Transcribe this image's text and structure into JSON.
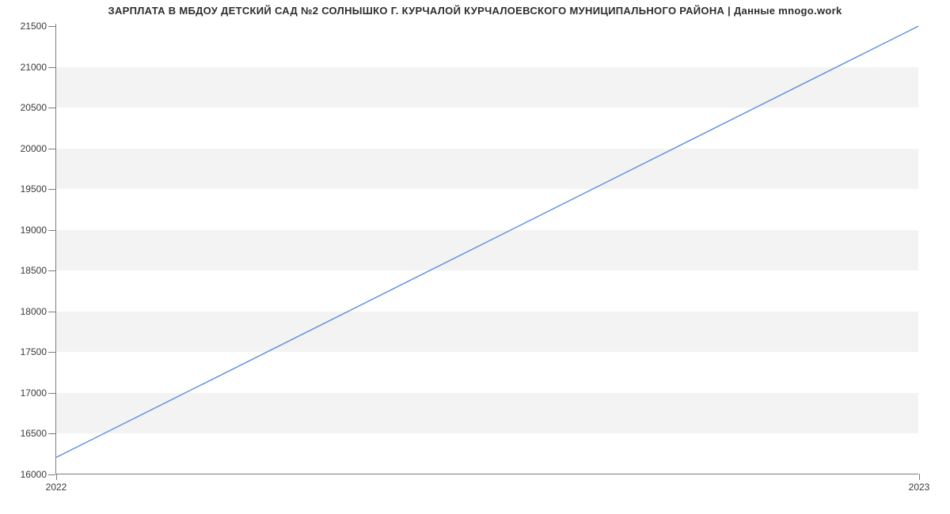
{
  "chart_data": {
    "type": "line",
    "title": "ЗАРПЛАТА В МБДОУ ДЕТСКИЙ САД №2 СОЛНЫШКО Г. КУРЧАЛОЙ КУРЧАЛОЕВСКОГО МУНИЦИПАЛЬНОГО РАЙОНА | Данные mnogo.work",
    "x": [
      2022,
      2023
    ],
    "values": [
      16200,
      21500
    ],
    "x_ticks": [
      2022,
      2023
    ],
    "y_ticks": [
      16000,
      16500,
      17000,
      17500,
      18000,
      18500,
      19000,
      19500,
      20000,
      20500,
      21000,
      21500
    ],
    "ylim": [
      16000,
      21530
    ],
    "xlim": [
      2022,
      2023
    ],
    "line_color": "#5b8fd6",
    "band_color": "#f3f3f3",
    "xlabel": "",
    "ylabel": ""
  }
}
